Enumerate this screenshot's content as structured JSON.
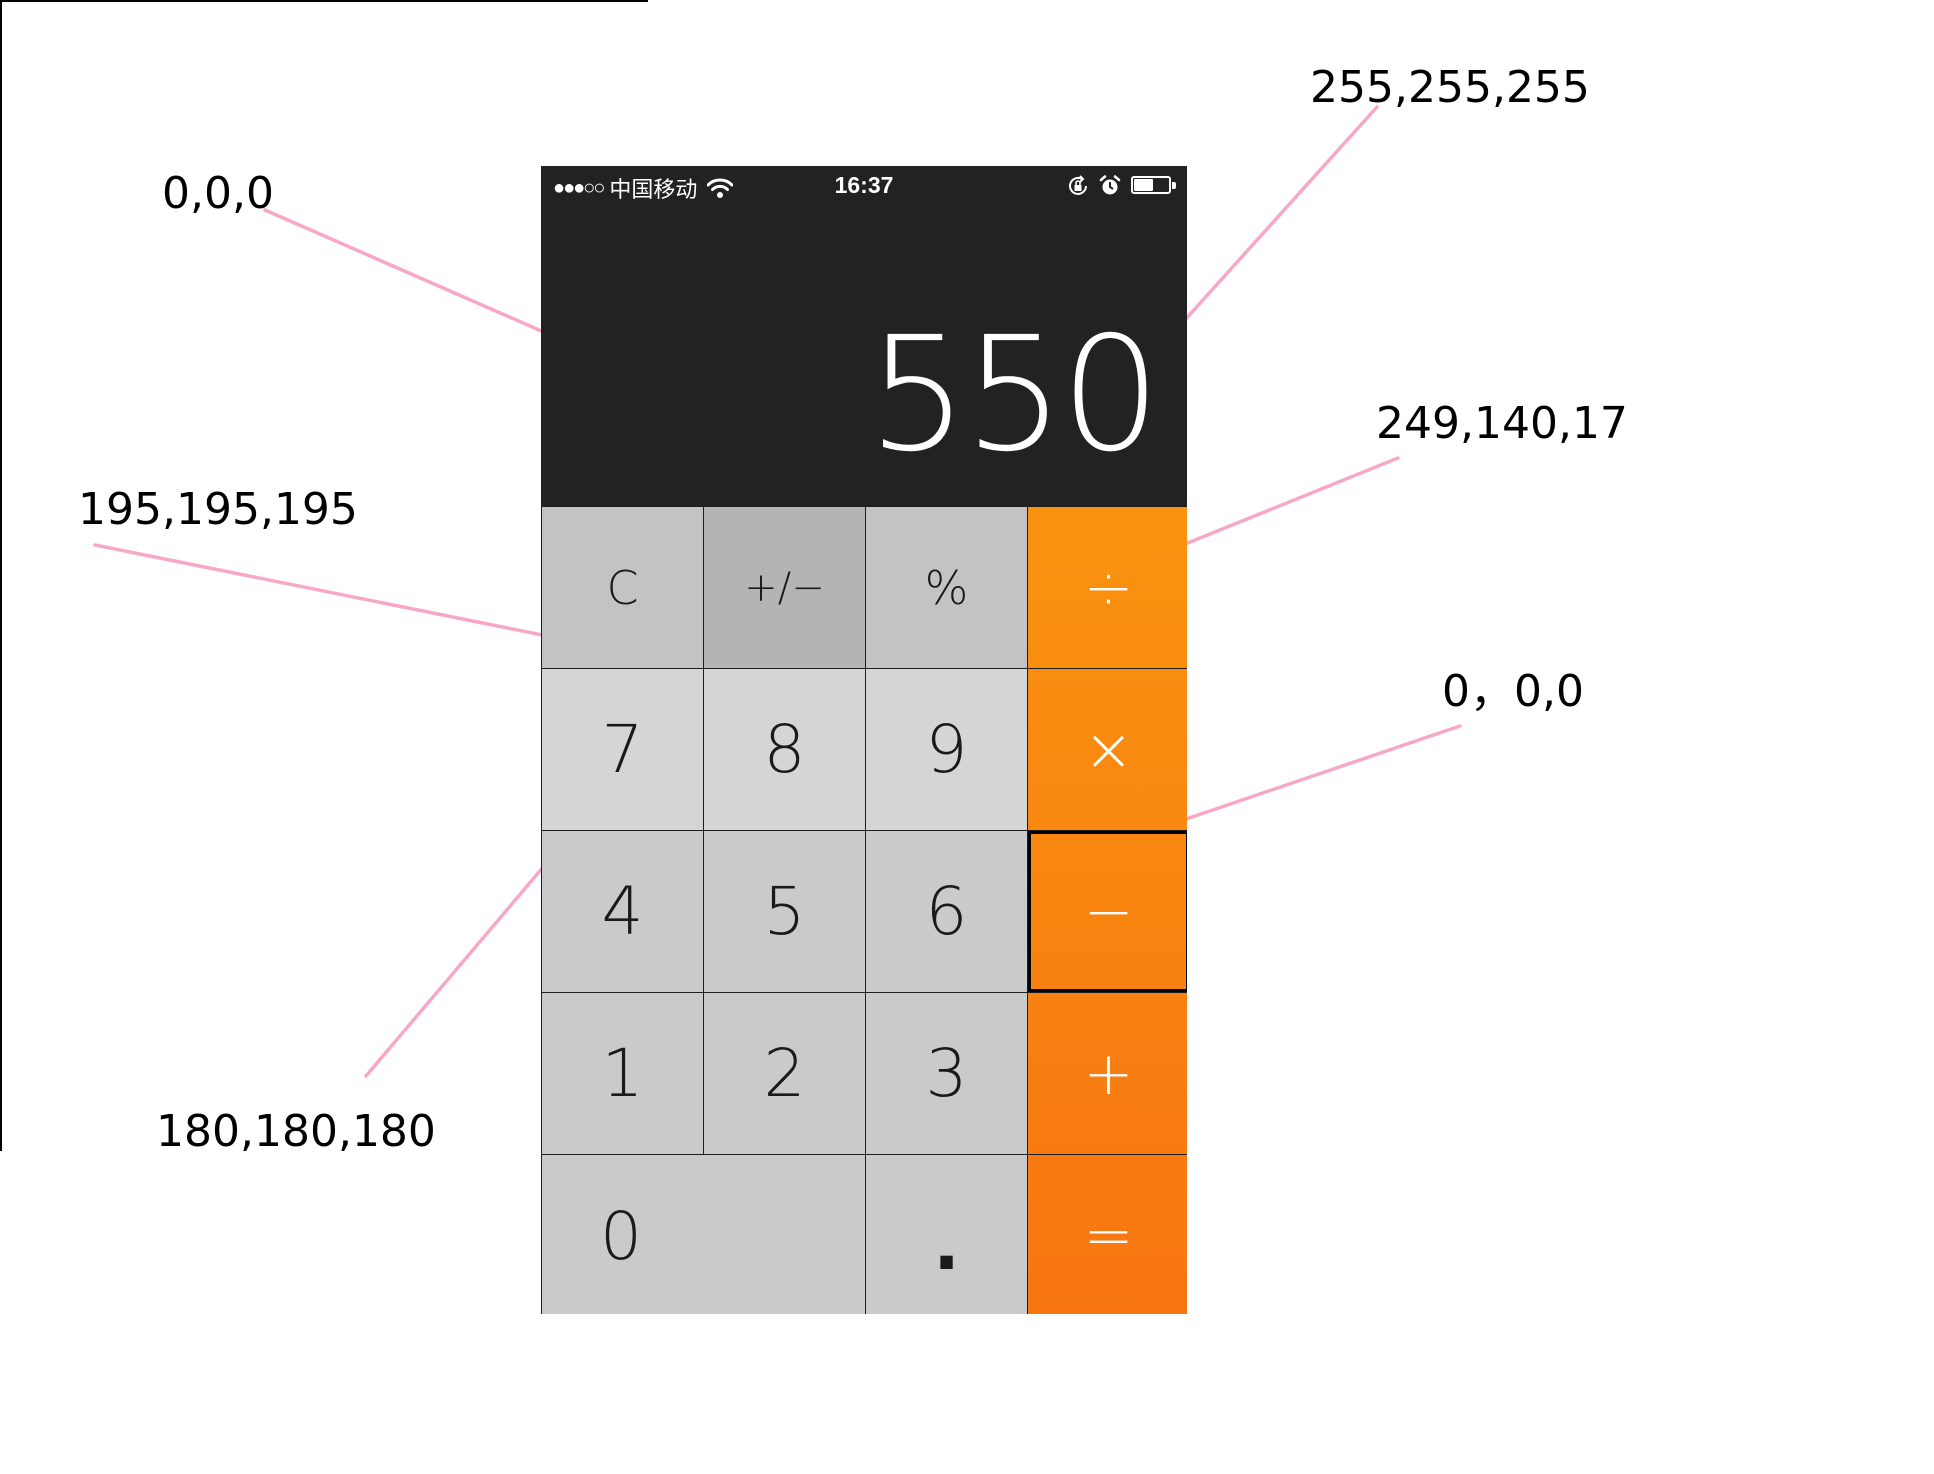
{
  "annotations": {
    "display_bg": "0,0,0",
    "display_text": "255,255,255",
    "operator_key": "249,140,17",
    "func_key": "195,195,195",
    "selected_border": "0，0,0",
    "active_key": "180,180,180"
  },
  "status_bar": {
    "signal": "●●●○○",
    "carrier": "中国移动",
    "time": "16:37",
    "battery_level": 0.55
  },
  "display": {
    "value": "550"
  },
  "keypad": {
    "rows": [
      [
        {
          "label": "C",
          "kind": "func",
          "name": "clear-button"
        },
        {
          "label": "+/−",
          "kind": "func",
          "name": "plus-minus-button",
          "active": true
        },
        {
          "label": "%",
          "kind": "func",
          "name": "percent-button"
        },
        {
          "label": "÷",
          "kind": "op",
          "name": "divide-button"
        }
      ],
      [
        {
          "label": "7",
          "kind": "num",
          "name": "digit-7-button"
        },
        {
          "label": "8",
          "kind": "num",
          "name": "digit-8-button"
        },
        {
          "label": "9",
          "kind": "num",
          "name": "digit-9-button"
        },
        {
          "label": "×",
          "kind": "op",
          "name": "multiply-button"
        }
      ],
      [
        {
          "label": "4",
          "kind": "num",
          "name": "digit-4-button"
        },
        {
          "label": "5",
          "kind": "num",
          "name": "digit-5-button"
        },
        {
          "label": "6",
          "kind": "num",
          "name": "digit-6-button"
        },
        {
          "label": "−",
          "kind": "op",
          "name": "subtract-button",
          "selected": true
        }
      ],
      [
        {
          "label": "1",
          "kind": "num",
          "name": "digit-1-button"
        },
        {
          "label": "2",
          "kind": "num",
          "name": "digit-2-button"
        },
        {
          "label": "3",
          "kind": "num",
          "name": "digit-3-button"
        },
        {
          "label": "+",
          "kind": "op",
          "name": "add-button"
        }
      ],
      [
        {
          "label": "0",
          "kind": "num",
          "name": "digit-0-button",
          "span": 2
        },
        {
          "label": ".",
          "kind": "num",
          "name": "decimal-button"
        },
        {
          "label": "=",
          "kind": "op",
          "name": "equals-button"
        }
      ]
    ]
  },
  "colors": {
    "display_bg": "#222222",
    "display_text": "#ffffff",
    "operator_top": "#f9930f",
    "operator_bottom": "#f87512",
    "func_key": "#c3c3c5",
    "active_key": "#b4b4b4",
    "num_key": "#d4d5d7",
    "leader_line": "#f7a8c8"
  }
}
